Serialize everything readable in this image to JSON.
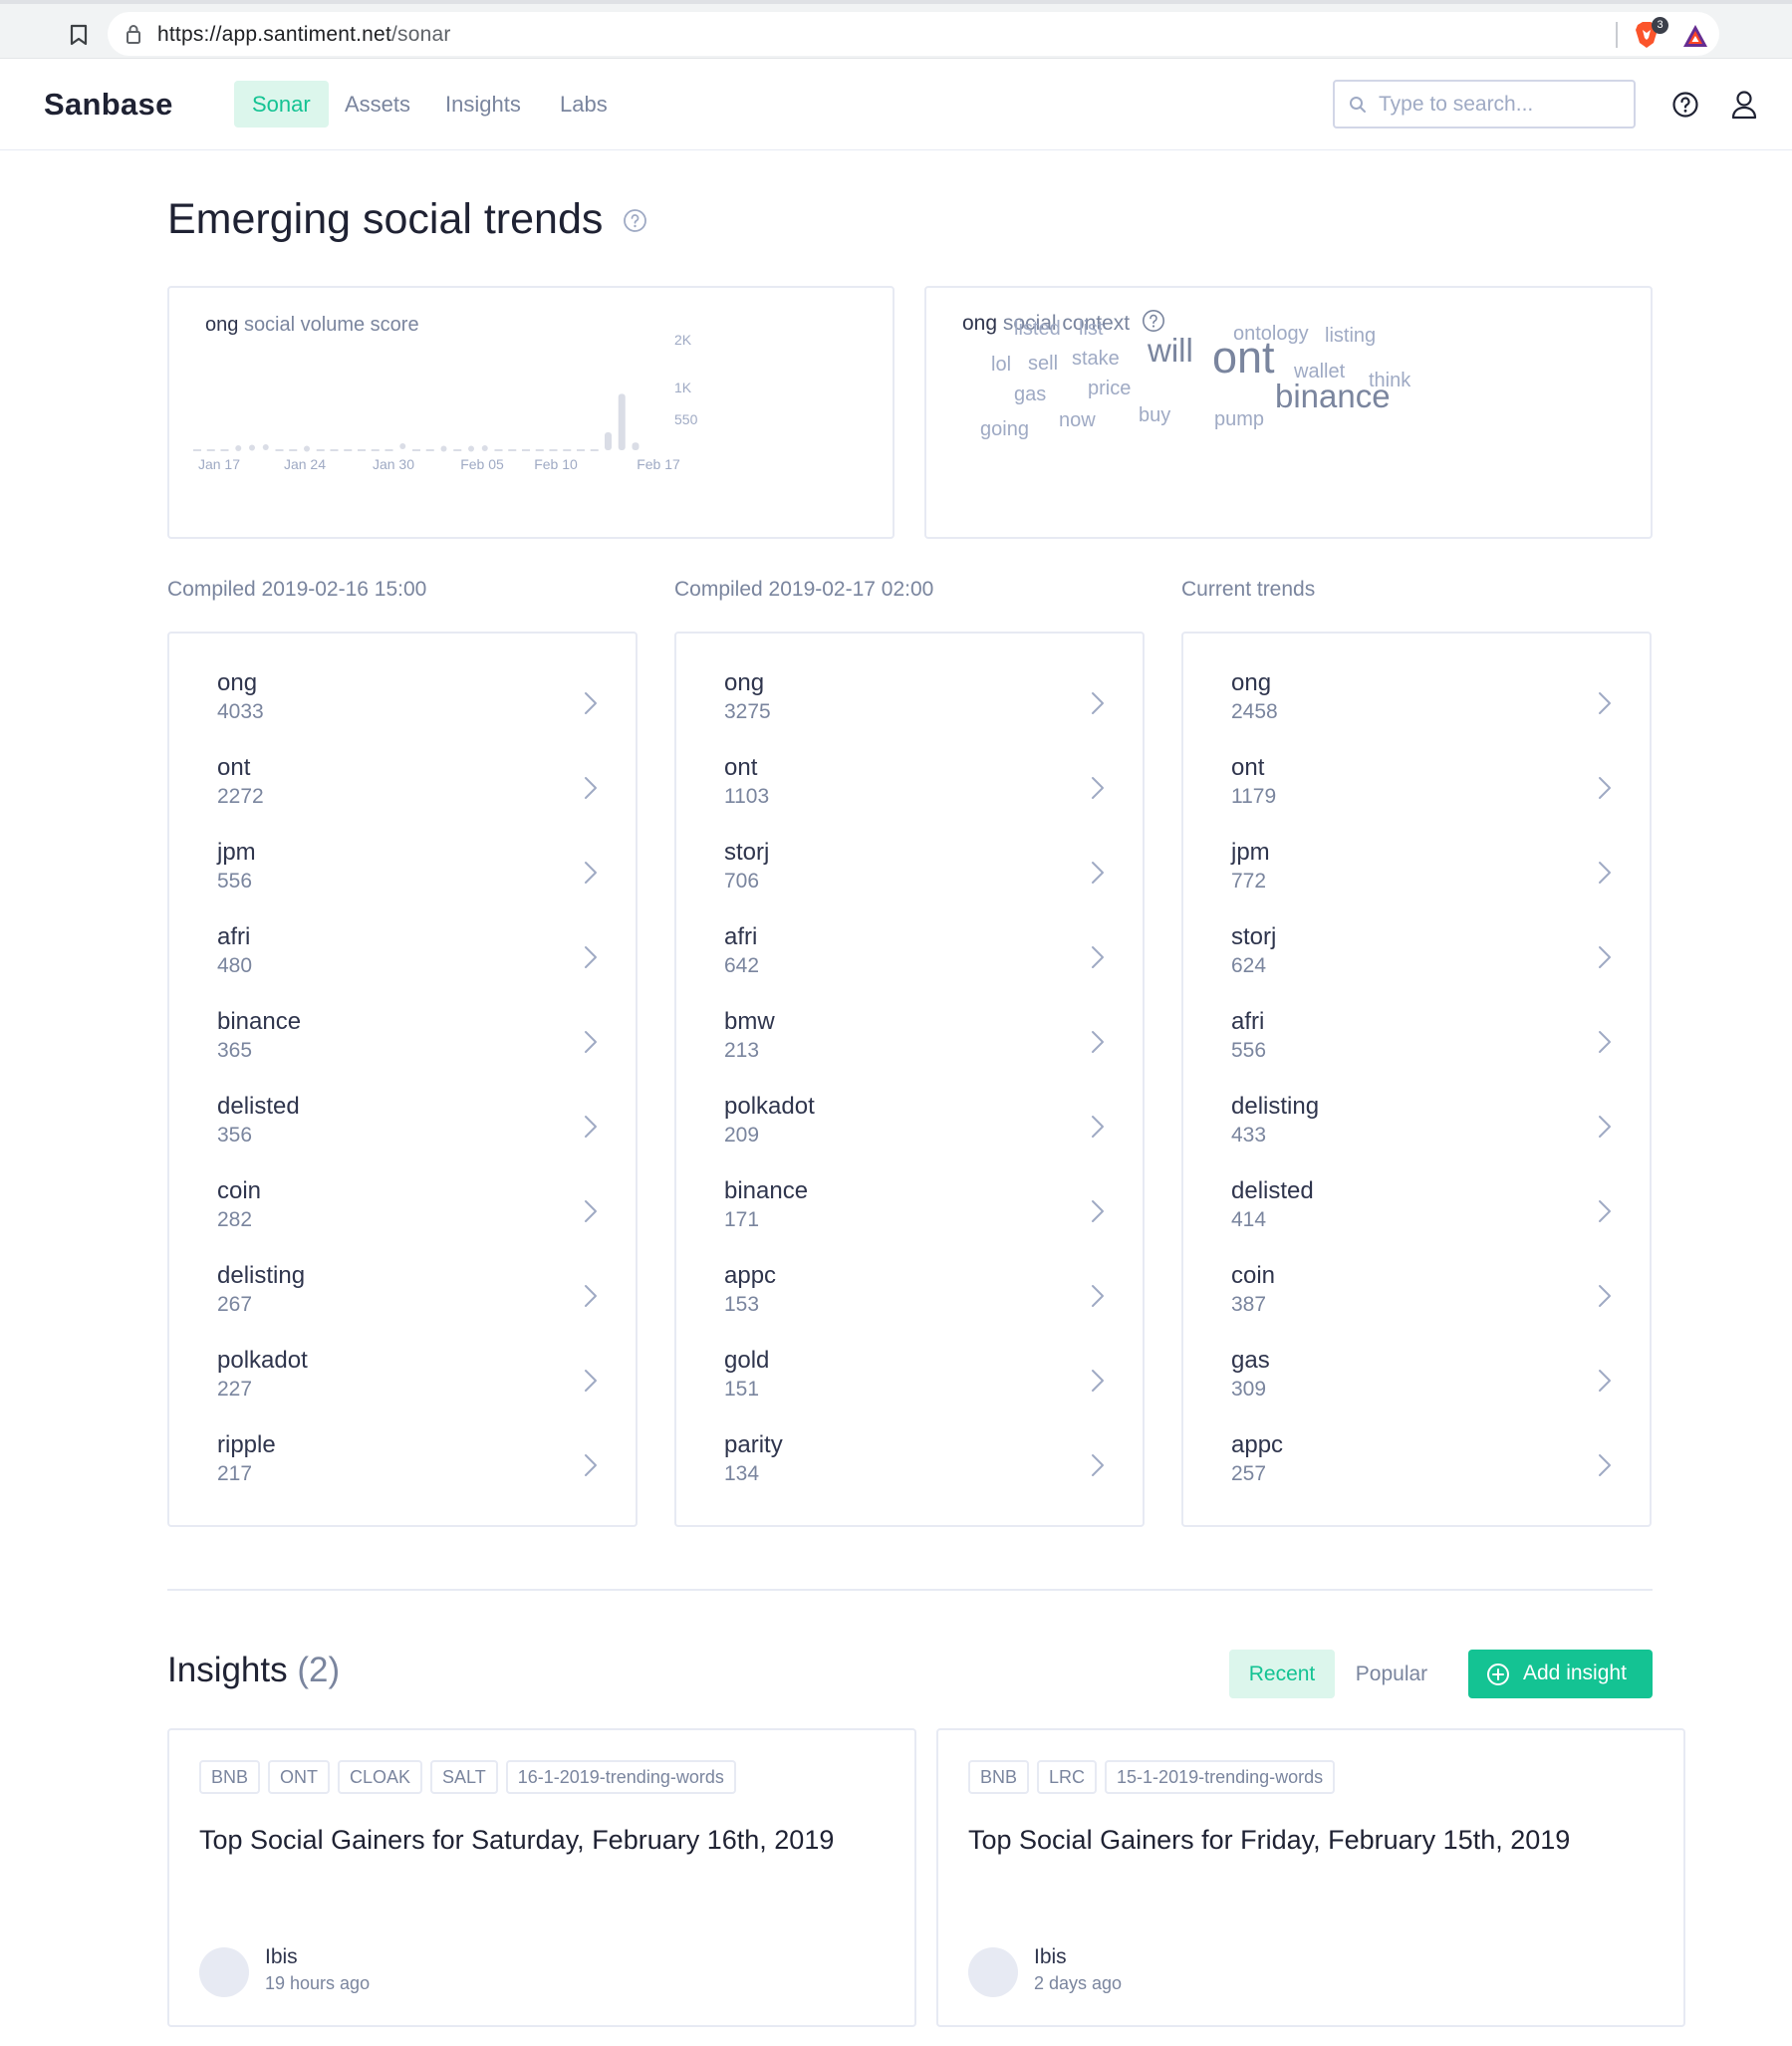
{
  "browser": {
    "url_host": "https://app.santiment.net",
    "url_path": "/sonar",
    "brave_badge": "3"
  },
  "header": {
    "logo": "Sanbase",
    "nav": [
      {
        "label": "Sonar",
        "active": true
      },
      {
        "label": "Assets",
        "active": false
      },
      {
        "label": "Insights",
        "active": false
      },
      {
        "label": "Labs",
        "active": false
      }
    ],
    "search_placeholder": "Type to search..."
  },
  "page": {
    "title": "Emerging social trends"
  },
  "volume_chart": {
    "word": "ong",
    "title_suffix": "social volume score"
  },
  "chart_data": {
    "type": "bar",
    "title": "ong social volume score",
    "x_tick_labels": [
      "Jan 17",
      "Jan 24",
      "Jan 30",
      "Feb 05",
      "Feb 10",
      "Feb 17"
    ],
    "y_tick_labels": [
      "550",
      "1K",
      "2K"
    ],
    "ylim": [
      0,
      2000
    ],
    "grid": false,
    "values": [
      0,
      0,
      0,
      20,
      30,
      40,
      0,
      0,
      10,
      0,
      0,
      0,
      0,
      0,
      0,
      60,
      0,
      0,
      10,
      0,
      10,
      20,
      0,
      0,
      0,
      0,
      0,
      0,
      0,
      0,
      350,
      1100,
      150
    ]
  },
  "context_cloud": {
    "word": "ong",
    "title_suffix": "social context",
    "words": [
      {
        "text": "listed",
        "size": 20
      },
      {
        "text": "list",
        "size": 20
      },
      {
        "text": "ontology",
        "size": 20
      },
      {
        "text": "listing",
        "size": 20
      },
      {
        "text": "lol",
        "size": 20
      },
      {
        "text": "sell",
        "size": 20
      },
      {
        "text": "stake",
        "size": 20
      },
      {
        "text": "will",
        "size": 33
      },
      {
        "text": "ont",
        "size": 45
      },
      {
        "text": "wallet",
        "size": 20
      },
      {
        "text": "think",
        "size": 20
      },
      {
        "text": "gas",
        "size": 20
      },
      {
        "text": "price",
        "size": 20
      },
      {
        "text": "binance",
        "size": 33
      },
      {
        "text": "going",
        "size": 20
      },
      {
        "text": "now",
        "size": 20
      },
      {
        "text": "buy",
        "size": 20
      },
      {
        "text": "pump",
        "size": 20
      }
    ]
  },
  "trend_columns": [
    {
      "caption": "Compiled 2019-02-16 15:00",
      "items": [
        {
          "word": "ong",
          "count": "4033"
        },
        {
          "word": "ont",
          "count": "2272"
        },
        {
          "word": "jpm",
          "count": "556"
        },
        {
          "word": "afri",
          "count": "480"
        },
        {
          "word": "binance",
          "count": "365"
        },
        {
          "word": "delisted",
          "count": "356"
        },
        {
          "word": "coin",
          "count": "282"
        },
        {
          "word": "delisting",
          "count": "267"
        },
        {
          "word": "polkadot",
          "count": "227"
        },
        {
          "word": "ripple",
          "count": "217"
        }
      ]
    },
    {
      "caption": "Compiled 2019-02-17 02:00",
      "items": [
        {
          "word": "ong",
          "count": "3275"
        },
        {
          "word": "ont",
          "count": "1103"
        },
        {
          "word": "storj",
          "count": "706"
        },
        {
          "word": "afri",
          "count": "642"
        },
        {
          "word": "bmw",
          "count": "213"
        },
        {
          "word": "polkadot",
          "count": "209"
        },
        {
          "word": "binance",
          "count": "171"
        },
        {
          "word": "appc",
          "count": "153"
        },
        {
          "word": "gold",
          "count": "151"
        },
        {
          "word": "parity",
          "count": "134"
        }
      ]
    },
    {
      "caption": "Current trends",
      "items": [
        {
          "word": "ong",
          "count": "2458"
        },
        {
          "word": "ont",
          "count": "1179"
        },
        {
          "word": "jpm",
          "count": "772"
        },
        {
          "word": "storj",
          "count": "624"
        },
        {
          "word": "afri",
          "count": "556"
        },
        {
          "word": "delisting",
          "count": "433"
        },
        {
          "word": "delisted",
          "count": "414"
        },
        {
          "word": "coin",
          "count": "387"
        },
        {
          "word": "gas",
          "count": "309"
        },
        {
          "word": "appc",
          "count": "257"
        }
      ]
    }
  ],
  "insights": {
    "title": "Insights",
    "count": "(2)",
    "recent_label": "Recent",
    "popular_label": "Popular",
    "add_label": "Add insight",
    "cards": [
      {
        "tags": [
          "BNB",
          "ONT",
          "CLOAK",
          "SALT",
          "16-1-2019-trending-words"
        ],
        "title": "Top Social Gainers for Saturday, February 16th, 2019",
        "author": "Ibis",
        "time": "19 hours ago"
      },
      {
        "tags": [
          "BNB",
          "LRC",
          "15-1-2019-trending-words"
        ],
        "title": "Top Social Gainers for Friday, February 15th, 2019",
        "author": "Ibis",
        "time": "2 days ago"
      }
    ]
  },
  "colors": {
    "accent": "#14c393",
    "accent_bg": "#dcf6ec",
    "text": "#2f354d",
    "muted": "#7a859e",
    "border": "#e7eaf3",
    "chart_bar": "#dadde6"
  }
}
